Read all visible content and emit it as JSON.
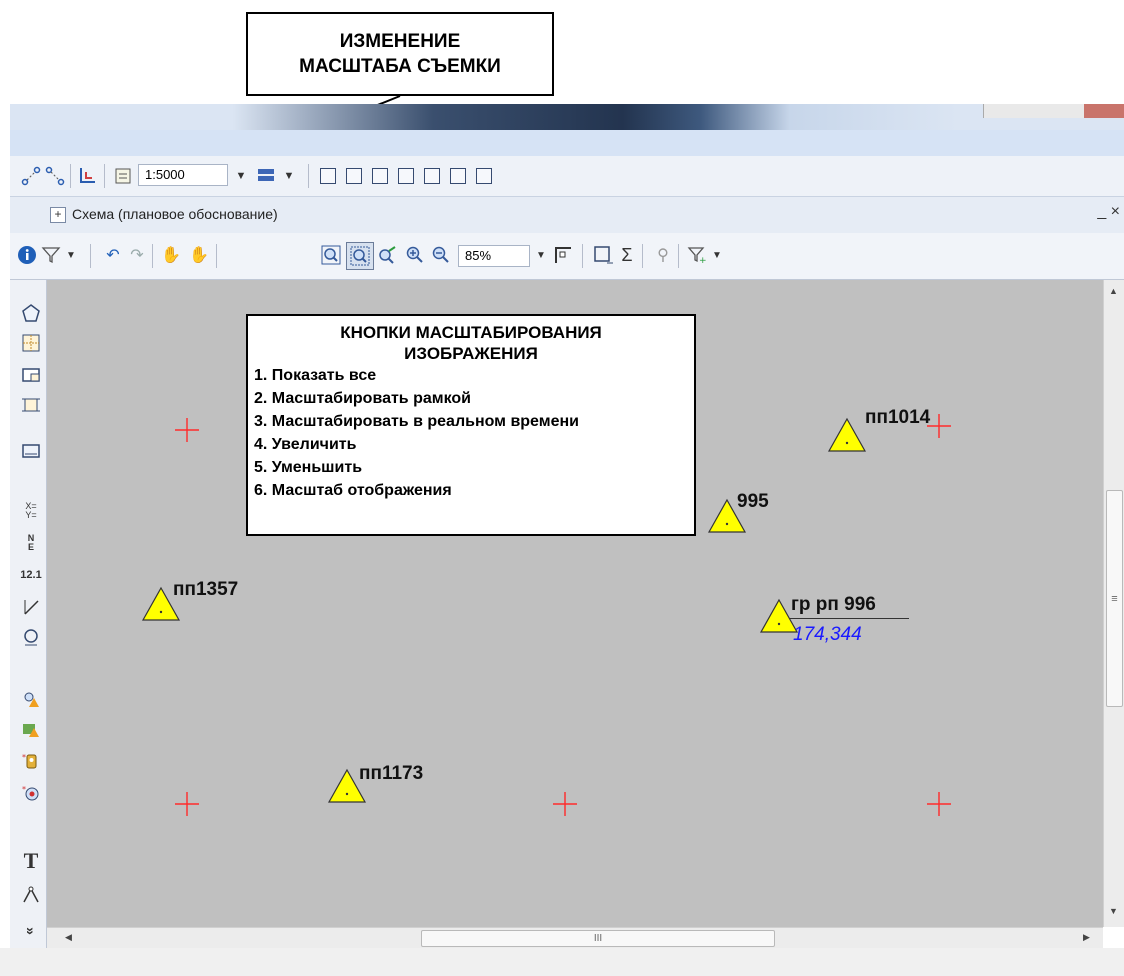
{
  "callouts": {
    "scale_change": [
      "ИЗМЕНЕНИЕ",
      "МАСШТАБА СЪЕМКИ"
    ],
    "zoom_buttons": {
      "title_lines": [
        "КНОПКИ МАСШТАБИРОВАНИЯ",
        "ИЗОБРАЖЕНИЯ"
      ],
      "items": [
        "1. Показать все",
        "2. Масштабировать рамкой",
        "3. Масштабировать в реальном времени",
        "4. Увеличить",
        "5. Уменьшить",
        "6. Масштаб отображения"
      ]
    }
  },
  "toolbar_top": {
    "scale_value": "1:5000"
  },
  "document": {
    "tab_title": "Схема (плановое обоснование)",
    "close_label": "_ ×"
  },
  "toolbar_view": {
    "zoom_value": "85%"
  },
  "map": {
    "points": [
      {
        "label": "пп1014"
      },
      {
        "label": "995"
      },
      {
        "label": "пп1357"
      },
      {
        "label": "гр рп 996",
        "value": "174,344"
      },
      {
        "label": "пп1173"
      }
    ],
    "grid_cross_color": "#ff2a2a",
    "point_fill_color": "#ffff00"
  },
  "scrollbar": {
    "h_thumb_label": "III",
    "v_thumb_label": "≡"
  },
  "left_toolbar": {
    "coord_label": "X=\nY=",
    "ne_label": "N\nE",
    "dist_label": "12.1",
    "text_tool_label": "T",
    "more_label": "»"
  }
}
